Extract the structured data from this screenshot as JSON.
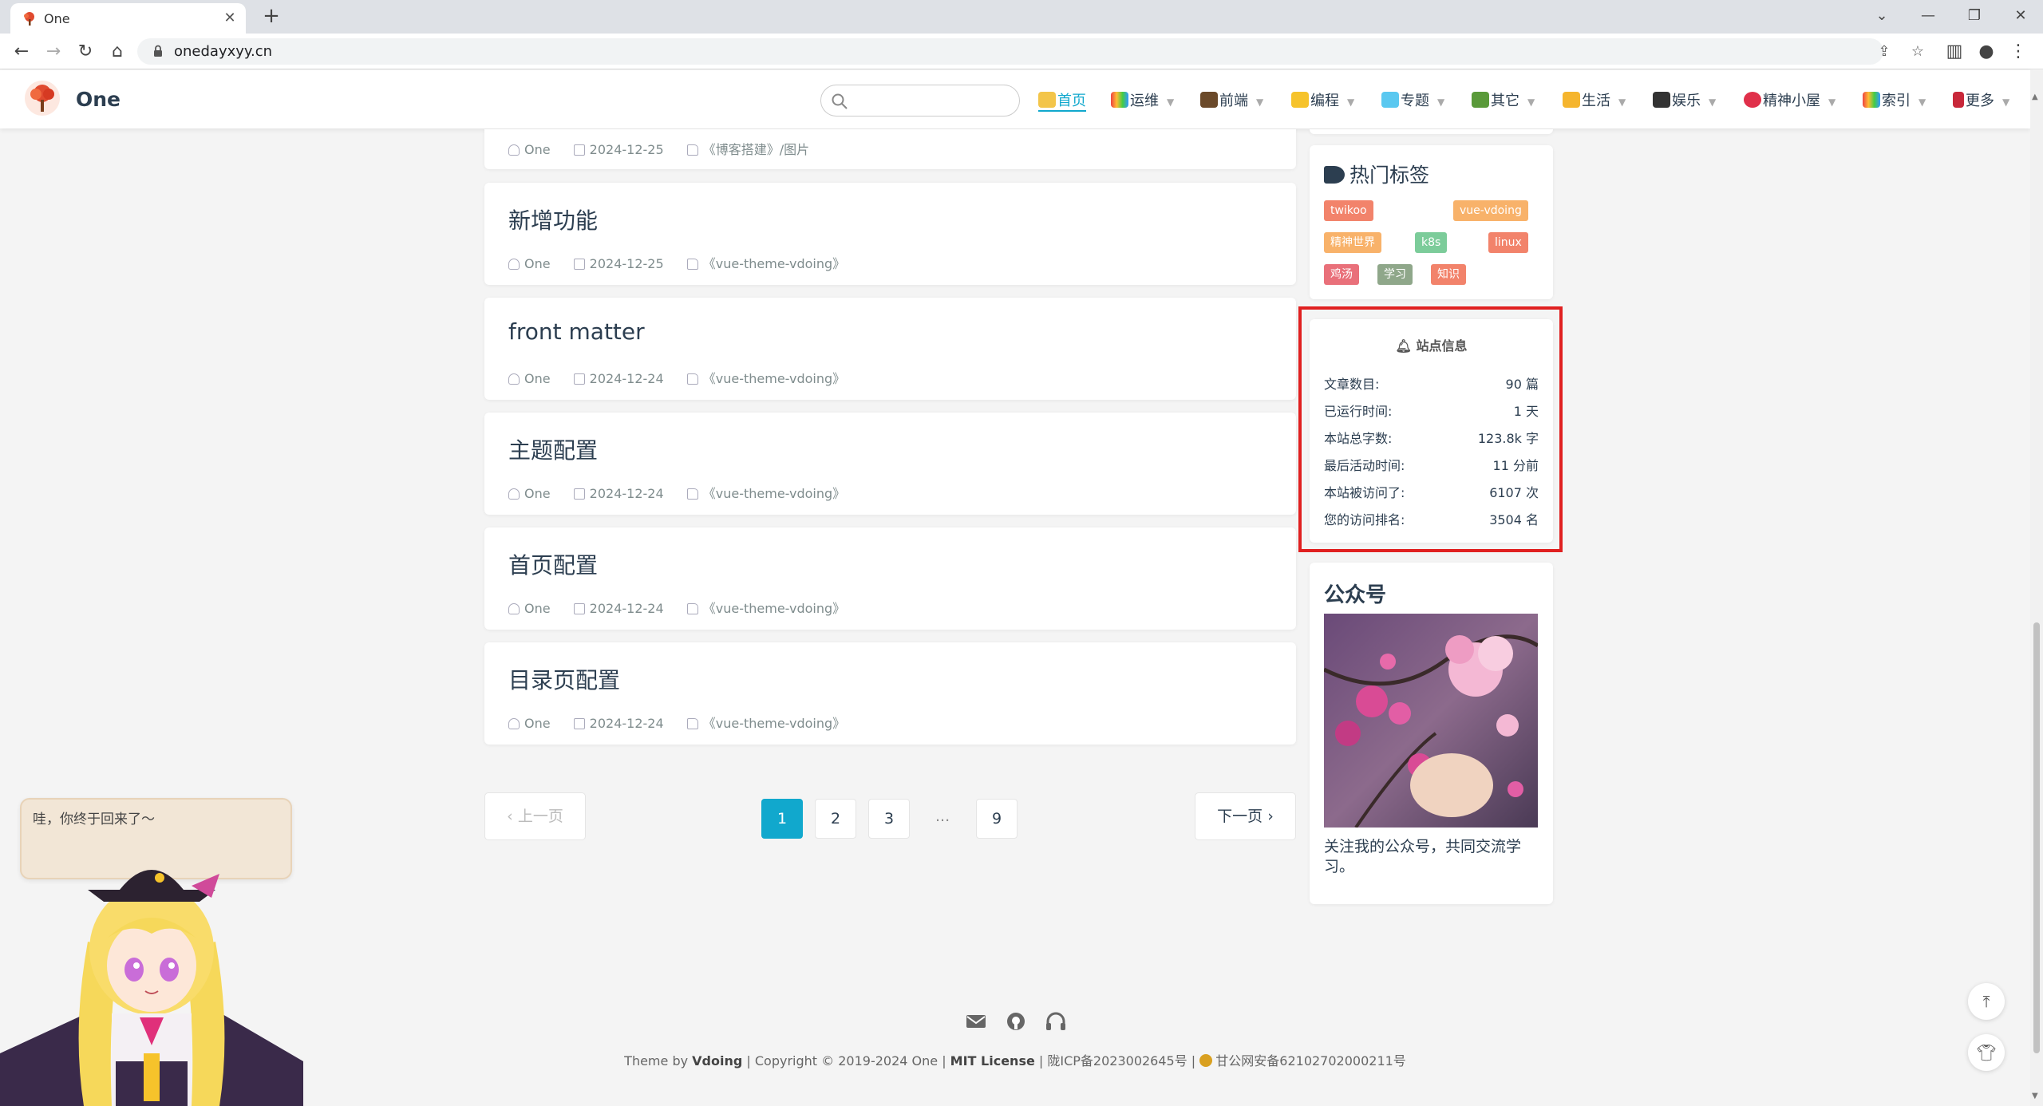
{
  "browser": {
    "tab_title": "One",
    "url": "onedayxyy.cn",
    "new_tab_symbol": "+",
    "close_symbol": "✕"
  },
  "header": {
    "site_title": "One",
    "nav": [
      {
        "label": "首页",
        "active": true,
        "icon": "house-icon"
      },
      {
        "label": "运维",
        "icon": "rainbow-icon"
      },
      {
        "label": "前端",
        "icon": "book-icon"
      },
      {
        "label": "编程",
        "icon": "lightning-icon"
      },
      {
        "label": "专题",
        "icon": "diamond-icon"
      },
      {
        "label": "其它",
        "icon": "turtle-icon"
      },
      {
        "label": "生活",
        "icon": "star-icon"
      },
      {
        "label": "娱乐",
        "icon": "camera-icon"
      },
      {
        "label": "精神小屋",
        "icon": "heart-icon"
      },
      {
        "label": "索引",
        "icon": "rainbow-icon"
      },
      {
        "label": "更多",
        "icon": "rose-icon"
      }
    ]
  },
  "posts": [
    {
      "title": "",
      "author": "One",
      "date": "2024-12-25",
      "category": "《博客搭建》/图片"
    },
    {
      "title": "新增功能",
      "author": "One",
      "date": "2024-12-25",
      "category": "《vue-theme-vdoing》"
    },
    {
      "title": "front matter",
      "author": "One",
      "date": "2024-12-24",
      "category": "《vue-theme-vdoing》"
    },
    {
      "title": "主题配置",
      "author": "One",
      "date": "2024-12-24",
      "category": "《vue-theme-vdoing》"
    },
    {
      "title": "首页配置",
      "author": "One",
      "date": "2024-12-24",
      "category": "《vue-theme-vdoing》"
    },
    {
      "title": "目录页配置",
      "author": "One",
      "date": "2024-12-24",
      "category": "《vue-theme-vdoing》"
    }
  ],
  "pagination": {
    "prev": "上一页",
    "next": "下一页",
    "pages": [
      "1",
      "2",
      "3",
      "9"
    ],
    "ellipsis": "...",
    "current": "1"
  },
  "tags": {
    "title": "热门标签",
    "items": [
      {
        "label": "twikoo",
        "color": "#f2836b"
      },
      {
        "label": "vue-vdoing",
        "color": "#f8b26a"
      },
      {
        "label": "精神世界",
        "color": "#f8b26a"
      },
      {
        "label": "k8s",
        "color": "#7ccc9a"
      },
      {
        "label": "linux",
        "color": "#f2836b"
      },
      {
        "label": "鸡汤",
        "color": "#e9707a"
      },
      {
        "label": "学习",
        "color": "#8fa78a"
      },
      {
        "label": "知识",
        "color": "#f2836b"
      }
    ]
  },
  "site_info": {
    "title": "站点信息",
    "rows": [
      {
        "label": "文章数目:",
        "value": "90 篇"
      },
      {
        "label": "已运行时间:",
        "value": "1 天"
      },
      {
        "label": "本站总字数:",
        "value": "123.8k 字"
      },
      {
        "label": "最后活动时间:",
        "value": "11 分前"
      },
      {
        "label": "本站被访问了:",
        "value": "6107 次"
      },
      {
        "label": "您的访问排名:",
        "value": "3504 名"
      }
    ]
  },
  "wechat": {
    "title": "公众号",
    "caption": "关注我的公众号，共同交流学习。"
  },
  "mascot": {
    "bubble_text": "哇，你终于回来了～"
  },
  "footer": {
    "theme_prefix": "Theme by ",
    "theme_name": "Vdoing",
    "copyright": " | Copyright © 2019-2024 One | ",
    "license": "MIT License",
    "icp": " | 陇ICP备2023002645号 | ",
    "police": "甘公网安备62102702000211号"
  },
  "colors": {
    "accent": "#11a8cd",
    "highlight_box": "#e02020"
  }
}
